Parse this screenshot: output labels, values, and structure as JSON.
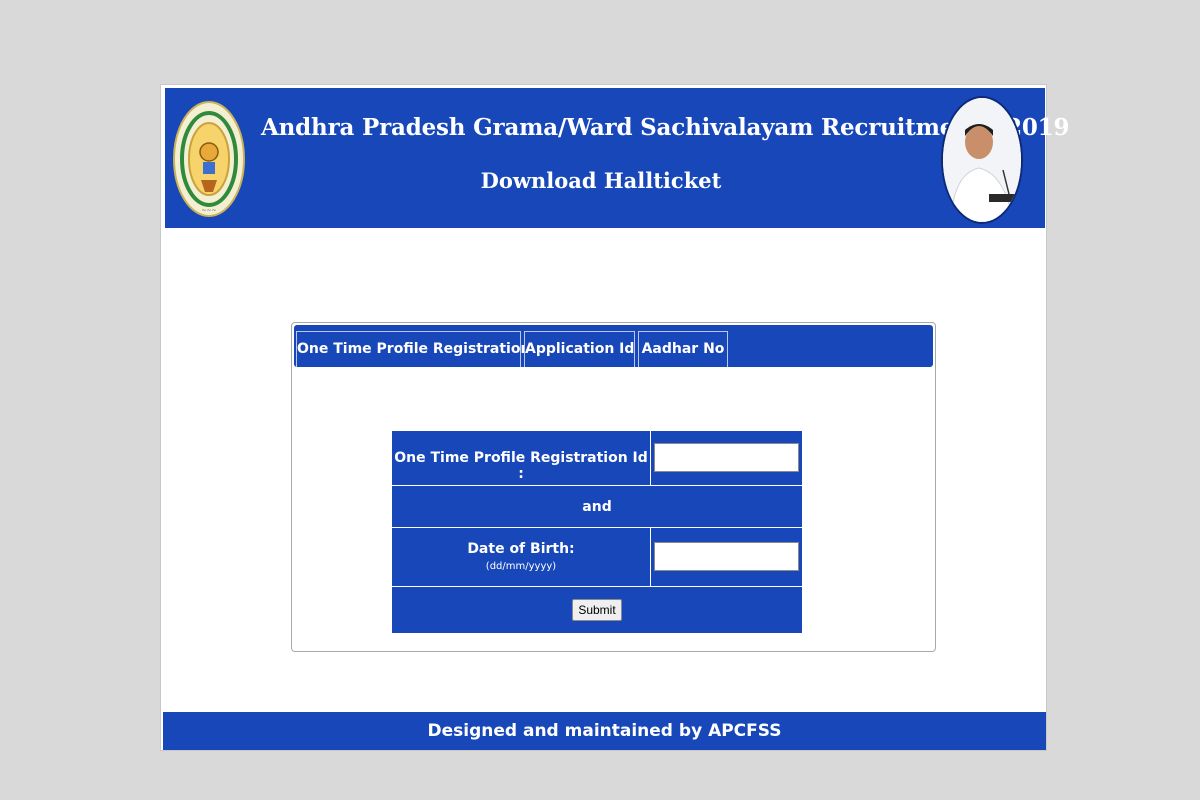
{
  "header": {
    "title": "Andhra Pradesh Grama/Ward Sachivalayam Recruitment - 2019",
    "subtitle": "Download Hallticket",
    "emblem_icon": "ap-state-emblem-icon",
    "portrait_icon": "portrait-photo"
  },
  "tabs": [
    {
      "label": "One Time Profile Registration Id",
      "selected": true
    },
    {
      "label": "Application Id",
      "selected": false
    },
    {
      "label": "Aadhar No",
      "selected": false
    }
  ],
  "form": {
    "id_label": "One Time Profile Registration Id :",
    "id_value": "",
    "and_label": "and",
    "dob_label": "Date of Birth:",
    "dob_format": "(dd/mm/yyyy)",
    "dob_value": "",
    "submit_label": "Submit"
  },
  "footer": {
    "text": "Designed and maintained by APCFSS"
  },
  "colors": {
    "brand_blue": "#1747b8",
    "page_background": "#d9d9d9",
    "text_on_brand": "#ffffff"
  }
}
